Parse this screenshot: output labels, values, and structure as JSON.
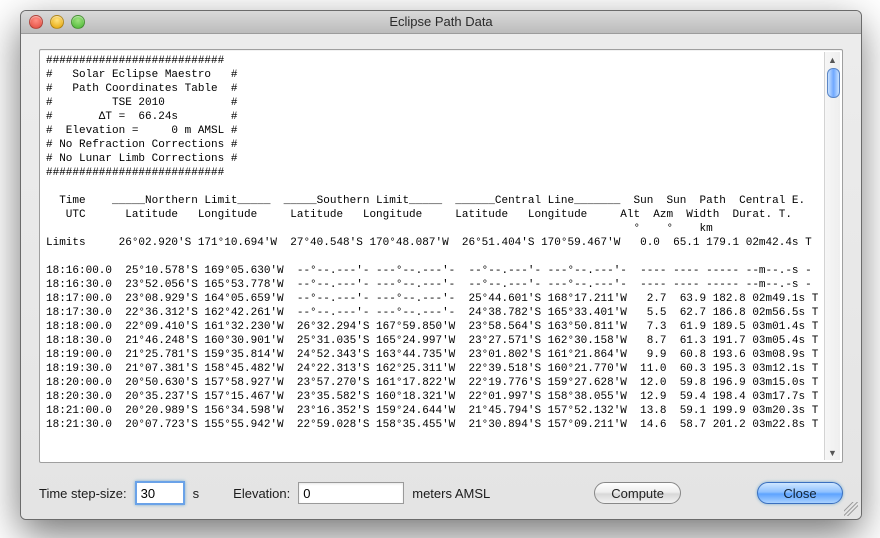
{
  "window": {
    "title": "Eclipse Path Data"
  },
  "controls": {
    "time_step_label": "Time step-size:",
    "time_step_value": "30",
    "time_step_unit": "s",
    "elevation_label": "Elevation:",
    "elevation_value": "0",
    "elevation_unit": "meters AMSL",
    "compute_label": "Compute",
    "close_label": "Close"
  },
  "header": {
    "divider": "###########################",
    "lines": [
      "#   Solar Eclipse Maestro   #",
      "#   Path Coordinates Table  #",
      "#         TSE 2010          #",
      "#       ΔT =  66.24s        #",
      "#  Elevation =     0 m AMSL #",
      "# No Refraction Corrections #",
      "# No Lunar Limb Corrections #"
    ]
  },
  "column_header": {
    "row1": "  Time    _____Northern Limit_____  _____Southern Limit_____  ______Central Line_______  Sun  Sun  Path  Central E.",
    "row2": "   UTC      Latitude   Longitude     Latitude   Longitude     Latitude   Longitude     Alt  Azm  Width  Durat. T.",
    "row3": "                                                                                         °    °    km"
  },
  "limits_row": "Limits     26°02.920'S 171°10.694'W  27°40.548'S 170°48.087'W  26°51.404'S 170°59.467'W   0.0  65.1 179.1 02m42.4s T",
  "rows": [
    "18:16:00.0  25°10.578'S 169°05.630'W  --°--.---'- ---°--.---'-  --°--.---'- ---°--.---'-  ---- ---- ----- --m--.-s -",
    "18:16:30.0  23°52.056'S 165°53.778'W  --°--.---'- ---°--.---'-  --°--.---'- ---°--.---'-  ---- ---- ----- --m--.-s -",
    "18:17:00.0  23°08.929'S 164°05.659'W  --°--.---'- ---°--.---'-  25°44.601'S 168°17.211'W   2.7  63.9 182.8 02m49.1s T",
    "18:17:30.0  22°36.312'S 162°42.261'W  --°--.---'- ---°--.---'-  24°38.782'S 165°33.401'W   5.5  62.7 186.8 02m56.5s T",
    "18:18:00.0  22°09.410'S 161°32.230'W  26°32.294'S 167°59.850'W  23°58.564'S 163°50.811'W   7.3  61.9 189.5 03m01.4s T",
    "18:18:30.0  21°46.248'S 160°30.901'W  25°31.035'S 165°24.997'W  23°27.571'S 162°30.158'W   8.7  61.3 191.7 03m05.4s T",
    "18:19:00.0  21°25.781'S 159°35.814'W  24°52.343'S 163°44.735'W  23°01.802'S 161°21.864'W   9.9  60.8 193.6 03m08.9s T",
    "18:19:30.0  21°07.381'S 158°45.482'W  24°22.313'S 162°25.311'W  22°39.518'S 160°21.770'W  11.0  60.3 195.3 03m12.1s T",
    "18:20:00.0  20°50.630'S 157°58.927'W  23°57.270'S 161°17.822'W  22°19.776'S 159°27.628'W  12.0  59.8 196.9 03m15.0s T",
    "18:20:30.0  20°35.237'S 157°15.467'W  23°35.582'S 160°18.321'W  22°01.997'S 158°38.055'W  12.9  59.4 198.4 03m17.7s T",
    "18:21:00.0  20°20.989'S 156°34.598'W  23°16.352'S 159°24.644'W  21°45.794'S 157°52.132'W  13.8  59.1 199.9 03m20.3s T",
    "18:21:30.0  20°07.723'S 155°55.942'W  22°59.028'S 158°35.455'W  21°30.894'S 157°09.211'W  14.6  58.7 201.2 03m22.8s T"
  ]
}
